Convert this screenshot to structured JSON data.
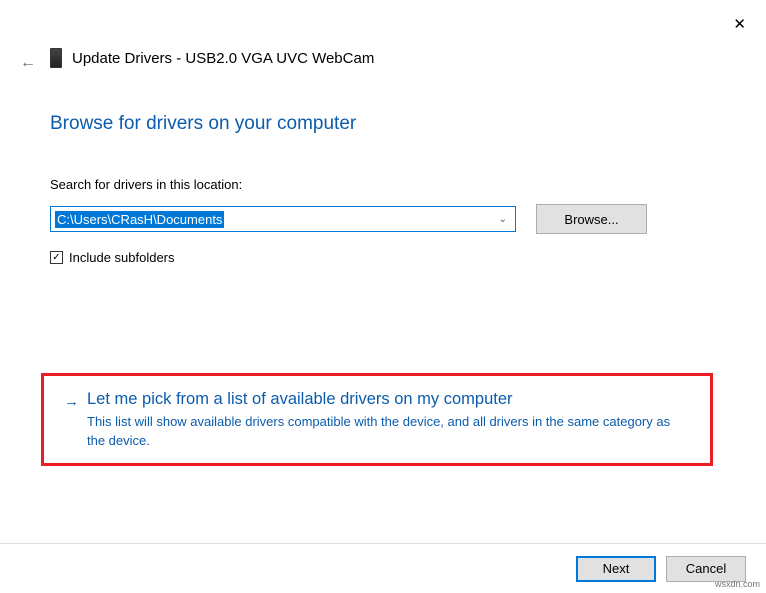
{
  "window": {
    "title": "Update Drivers - USB2.0 VGA UVC WebCam"
  },
  "heading": "Browse for drivers on your computer",
  "search": {
    "label": "Search for drivers in this location:",
    "path": "C:\\Users\\CRasH\\Documents",
    "browse": "Browse..."
  },
  "checkbox": {
    "label": "Include subfolders",
    "checked": true
  },
  "option": {
    "title": "Let me pick from a list of available drivers on my computer",
    "description": "This list will show available drivers compatible with the device, and all drivers in the same category as the device."
  },
  "buttons": {
    "next": "Next",
    "cancel": "Cancel"
  },
  "watermark": "wsxdn.com"
}
